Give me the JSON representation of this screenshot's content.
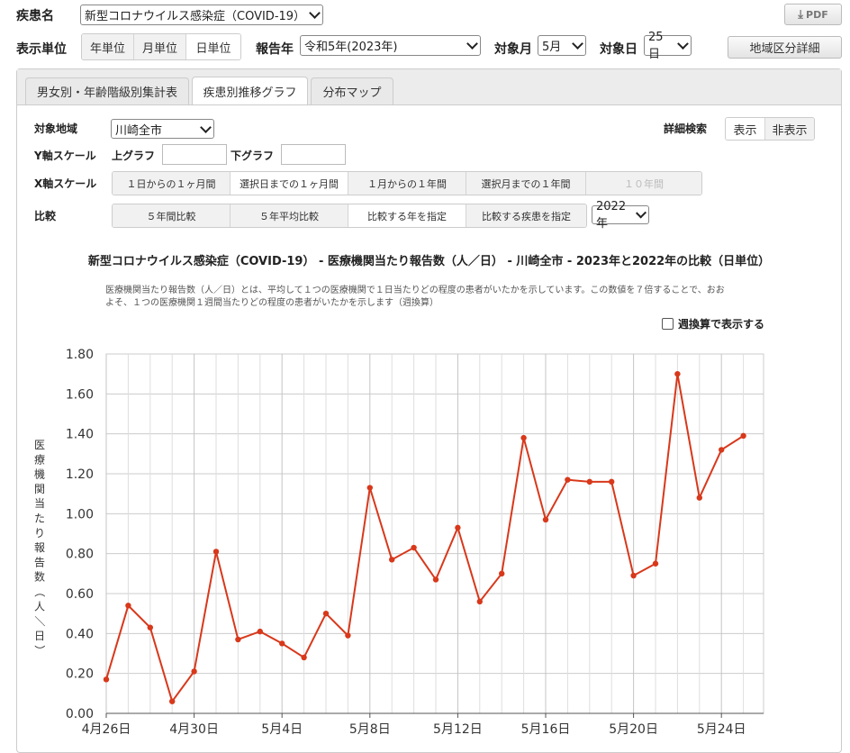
{
  "top": {
    "disease_label": "疾患名",
    "disease_value": "新型コロナウイルス感染症（COVID-19）",
    "pdf_label": "PDF",
    "unit_label": "表示単位",
    "units": [
      "年単位",
      "月単位",
      "日単位"
    ],
    "year_label": "報告年",
    "year_value": "令和5年(2023年)",
    "month_label": "対象月",
    "month_value": "5月",
    "day_label": "対象日",
    "day_value": "25日",
    "region_detail_button": "地域区分詳細"
  },
  "tabs": [
    "男女別・年齢階級別集計表",
    "疾患別推移グラフ",
    "分布マップ"
  ],
  "form": {
    "area_label": "対象地域",
    "area_value": "川崎全市",
    "detail_label": "詳細検索",
    "detail_show": "表示",
    "detail_hide": "非表示",
    "yscale_label": "Y軸スケール",
    "upper_graph": "上グラフ",
    "lower_graph": "下グラフ",
    "xscale_label": "X軸スケール",
    "xscale_options": [
      "１日からの１ヶ月間",
      "選択日までの１ヶ月間",
      "１月からの１年間",
      "選択月までの１年間",
      "１０年間"
    ],
    "compare_label": "比較",
    "compare_options": [
      "５年間比較",
      "５年平均比較",
      "比較する年を指定",
      "比較する疾患を指定"
    ],
    "compare_year_value": "2022年"
  },
  "chart_header": {
    "title": "新型コロナウイルス感染症（COVID-19） - 医療機関当たり報告数（人／日） - 川崎全市 - 2023年と2022年の比較（日単位）",
    "note_line1": "医療機関当たり報告数（人／日）とは、平均して１つの医療機関で１日当たりどの程度の患者がいたかを示しています。この数値を７倍することで、おお",
    "note_line2": "よそ、１つの医療機関１週間当たりどの程度の患者がいたかを示します（週換算）",
    "weekly_checkbox_label": "週換算で表示する"
  },
  "chart_data": {
    "type": "line",
    "ylabel": "医療機関当たり報告数（人／日）",
    "ylim": [
      0,
      1.8
    ],
    "y_ticks": [
      "0.00",
      "0.20",
      "0.40",
      "0.60",
      "0.80",
      "1.00",
      "1.20",
      "1.40",
      "1.60",
      "1.80"
    ],
    "x_tick_labels": [
      "4月26日",
      "4月30日",
      "5月4日",
      "5月8日",
      "5月12日",
      "5月16日",
      "5月20日",
      "5月24日"
    ],
    "x": [
      "4/26",
      "4/27",
      "4/28",
      "4/29",
      "4/30",
      "5/1",
      "5/2",
      "5/3",
      "5/4",
      "5/5",
      "5/6",
      "5/7",
      "5/8",
      "5/9",
      "5/10",
      "5/11",
      "5/12",
      "5/13",
      "5/14",
      "5/15",
      "5/16",
      "5/17",
      "5/18",
      "5/19",
      "5/20",
      "5/21",
      "5/22",
      "5/23",
      "5/24",
      "5/25"
    ],
    "values": [
      0.17,
      0.54,
      0.43,
      0.06,
      0.21,
      0.81,
      0.37,
      0.41,
      0.35,
      0.28,
      0.5,
      0.39,
      1.13,
      0.77,
      0.83,
      0.67,
      0.93,
      0.56,
      0.7,
      1.38,
      0.97,
      1.17,
      1.16,
      1.16,
      0.69,
      0.75,
      1.7,
      1.08,
      1.32,
      1.39
    ],
    "grid": true,
    "color": "#d8381b"
  }
}
